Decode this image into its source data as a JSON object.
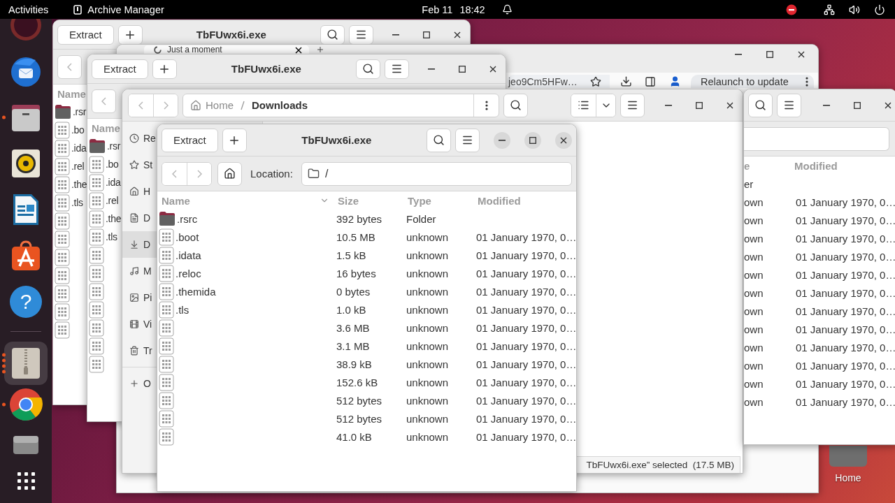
{
  "top_bar": {
    "activities": "Activities",
    "app": "Archive Manager",
    "date": "Feb 11",
    "time": "18:42"
  },
  "dock": {
    "favorites": [
      {
        "kind": "ubuntu",
        "running": false,
        "selected": false
      },
      {
        "kind": "thunderbird",
        "running": false,
        "selected": false
      },
      {
        "kind": "files",
        "running": true,
        "several": false,
        "selected": false
      },
      {
        "kind": "rhythmbox",
        "running": false,
        "selected": false
      },
      {
        "kind": "writer",
        "running": false,
        "selected": false
      },
      {
        "kind": "appcenter",
        "running": false,
        "selected": false
      },
      {
        "kind": "help",
        "glyph": "?",
        "running": false,
        "selected": false
      }
    ],
    "open": [
      {
        "kind": "archive",
        "running": true,
        "several": true,
        "selected": true
      },
      {
        "kind": "chrome",
        "running": true,
        "several": false,
        "selected": false
      },
      {
        "kind": "drive",
        "running": false,
        "selected": false
      }
    ]
  },
  "desktop_icons": [
    {
      "label": "Home"
    }
  ],
  "windows": [
    {
      "kind": "archive",
      "title": "TbFUwx6i.exe",
      "extract": "Extract",
      "columns": [
        "Name"
      ],
      "rows": [
        {
          "kind": "folder",
          "name": ".rsr"
        },
        {
          "kind": "file",
          "name": ".bo"
        },
        {
          "kind": "file",
          "name": ".ida"
        },
        {
          "kind": "file",
          "name": ".rel"
        },
        {
          "kind": "file",
          "name": ".the"
        },
        {
          "kind": "file",
          "name": ".tls"
        },
        {
          "kind": "file"
        },
        {
          "kind": "file"
        },
        {
          "kind": "file"
        },
        {
          "kind": "file"
        },
        {
          "kind": "file"
        },
        {
          "kind": "file"
        },
        {
          "kind": "file"
        }
      ]
    },
    {
      "kind": "browser",
      "tab": "Just a moment",
      "url": "jeo9Cm5HFw…",
      "relaunch": "Relaunch to update"
    },
    {
      "kind": "archive",
      "title": "TbFUwx6i.exe",
      "extract": "Extract",
      "columns": [
        "Name"
      ],
      "rows": [
        {
          "kind": "folder",
          "name": ".rsr"
        },
        {
          "kind": "file",
          "name": ".bo"
        },
        {
          "kind": "file",
          "name": ".ida"
        },
        {
          "kind": "file",
          "name": ".rel"
        },
        {
          "kind": "file",
          "name": ".the"
        },
        {
          "kind": "file",
          "name": ".tls"
        },
        {
          "kind": "file"
        },
        {
          "kind": "file"
        },
        {
          "kind": "file"
        },
        {
          "kind": "file"
        },
        {
          "kind": "file"
        },
        {
          "kind": "file"
        },
        {
          "kind": "file"
        }
      ]
    },
    {
      "kind": "files",
      "path": [
        "Home",
        "Downloads"
      ],
      "sidebar": [
        {
          "kind": "recent",
          "label": "Re",
          "selected": false
        },
        {
          "kind": "starred",
          "label": "St",
          "selected": false
        },
        {
          "kind": "home",
          "label": "H",
          "selected": false
        },
        {
          "kind": "documents",
          "label": "D",
          "selected": false
        },
        {
          "kind": "downloads",
          "label": "D",
          "selected": true
        },
        {
          "kind": "music",
          "label": "M",
          "selected": false
        },
        {
          "kind": "pictures",
          "label": "Pi",
          "selected": false
        },
        {
          "kind": "videos",
          "label": "Vi",
          "selected": false
        },
        {
          "kind": "trash",
          "label": "Tr",
          "selected": false
        },
        {
          "kind": "other",
          "label": "O",
          "selected": false
        }
      ],
      "status": "TbFUwx6i.exe” selected  (17.5 MB)"
    },
    {
      "kind": "archive",
      "front": true,
      "title": "TbFUwx6i.exe",
      "extract": "Extract",
      "location": {
        "label": "Location:",
        "path": "/"
      },
      "columns": [
        "Name",
        "Size",
        "Type",
        "Modified"
      ],
      "rows": [
        {
          "kind": "folder",
          "name": ".rsrc",
          "size": "392 bytes",
          "type": "Folder"
        },
        {
          "kind": "file",
          "name": ".boot",
          "size": "10.5 MB",
          "type": "unknown",
          "modified": "01 January 1970, 0…"
        },
        {
          "kind": "file",
          "name": ".idata",
          "size": "1.5 kB",
          "type": "unknown",
          "modified": "01 January 1970, 0…"
        },
        {
          "kind": "file",
          "name": ".reloc",
          "size": "16 bytes",
          "type": "unknown",
          "modified": "01 January 1970, 0…"
        },
        {
          "kind": "file",
          "name": ".themida",
          "size": "0 bytes",
          "type": "unknown",
          "modified": "01 January 1970, 0…"
        },
        {
          "kind": "file",
          "name": ".tls",
          "size": "1.0 kB",
          "type": "unknown",
          "modified": "01 January 1970, 0…"
        },
        {
          "kind": "file",
          "size": "3.6 MB",
          "type": "unknown",
          "modified": "01 January 1970, 0…"
        },
        {
          "kind": "file",
          "size": "3.1 MB",
          "type": "unknown",
          "modified": "01 January 1970, 0…"
        },
        {
          "kind": "file",
          "size": "38.9 kB",
          "type": "unknown",
          "modified": "01 January 1970, 0…"
        },
        {
          "kind": "file",
          "size": "152.6 kB",
          "type": "unknown",
          "modified": "01 January 1970, 0…"
        },
        {
          "kind": "file",
          "size": "512 bytes",
          "type": "unknown",
          "modified": "01 January 1970, 0…"
        },
        {
          "kind": "file",
          "size": "512 bytes",
          "type": "unknown",
          "modified": "01 January 1970, 0…"
        },
        {
          "kind": "file",
          "size": "41.0 kB",
          "type": "unknown",
          "modified": "01 January 1970, 0…"
        }
      ]
    },
    {
      "kind": "archive_partial",
      "columns": [
        "e",
        "Modified"
      ],
      "rows": [
        {
          "type": "er"
        },
        {
          "type": "own",
          "modified": "01 January 1970, 0…"
        },
        {
          "type": "own",
          "modified": "01 January 1970, 0…"
        },
        {
          "type": "own",
          "modified": "01 January 1970, 0…"
        },
        {
          "type": "own",
          "modified": "01 January 1970, 0…"
        },
        {
          "type": "own",
          "modified": "01 January 1970, 0…"
        },
        {
          "type": "own",
          "modified": "01 January 1970, 0…"
        },
        {
          "type": "own",
          "modified": "01 January 1970, 0…"
        },
        {
          "type": "own",
          "modified": "01 January 1970, 0…"
        },
        {
          "type": "own",
          "modified": "01 January 1970, 0…"
        },
        {
          "type": "own",
          "modified": "01 January 1970, 0…"
        },
        {
          "type": "own",
          "modified": "01 January 1970, 0…"
        },
        {
          "type": "own",
          "modified": "01 January 1970, 0…"
        }
      ]
    }
  ]
}
